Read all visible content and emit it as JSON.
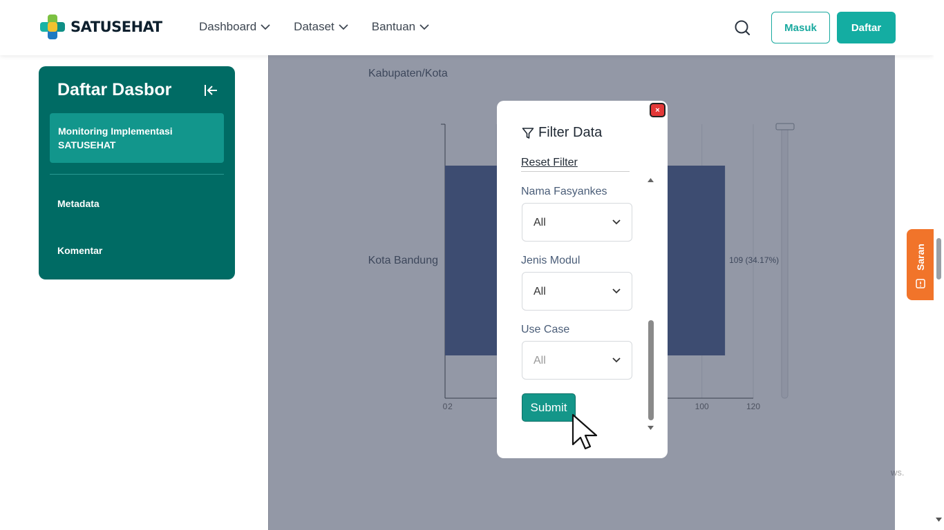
{
  "header": {
    "brand": "SATUSEHAT",
    "nav": [
      {
        "label": "Dashboard"
      },
      {
        "label": "Dataset"
      },
      {
        "label": "Bantuan"
      }
    ],
    "login_label": "Masuk",
    "register_label": "Daftar"
  },
  "sidebar": {
    "title": "Daftar Dasbor",
    "active_item": "Monitoring Implementasi SATUSEHAT",
    "items": [
      {
        "label": "Metadata"
      },
      {
        "label": "Komentar"
      }
    ]
  },
  "chart": {
    "title": "Kabupaten/Kota",
    "category_label": "Kota Bandung",
    "value_label": "109 (34.17%)",
    "ticks": [
      "0",
      "2",
      "100",
      "120"
    ],
    "footer_fragment": "ws."
  },
  "chart_data": {
    "type": "bar",
    "orientation": "horizontal",
    "categories": [
      "Kota Bandung"
    ],
    "values": [
      109
    ],
    "data_labels": [
      "109 (34.17%)"
    ],
    "title": "Kabupaten/Kota",
    "xlim": [
      0,
      120
    ],
    "grid": true
  },
  "modal": {
    "title": "Filter Data",
    "reset_label": "Reset Filter",
    "fields": [
      {
        "label": "Nama Fasyankes",
        "value": "All"
      },
      {
        "label": "Jenis Modul",
        "value": "All"
      },
      {
        "label": "Use Case",
        "value": "All"
      }
    ],
    "submit_label": "Submit",
    "close_label": "×"
  },
  "feedback_tab": {
    "label": "Saran"
  },
  "colors": {
    "primary": "#14ada2",
    "sidebar": "#006b64",
    "sidebar_active": "#12968c",
    "bar": "#5b6d99",
    "feedback": "#f1742a",
    "close": "#e33838"
  }
}
